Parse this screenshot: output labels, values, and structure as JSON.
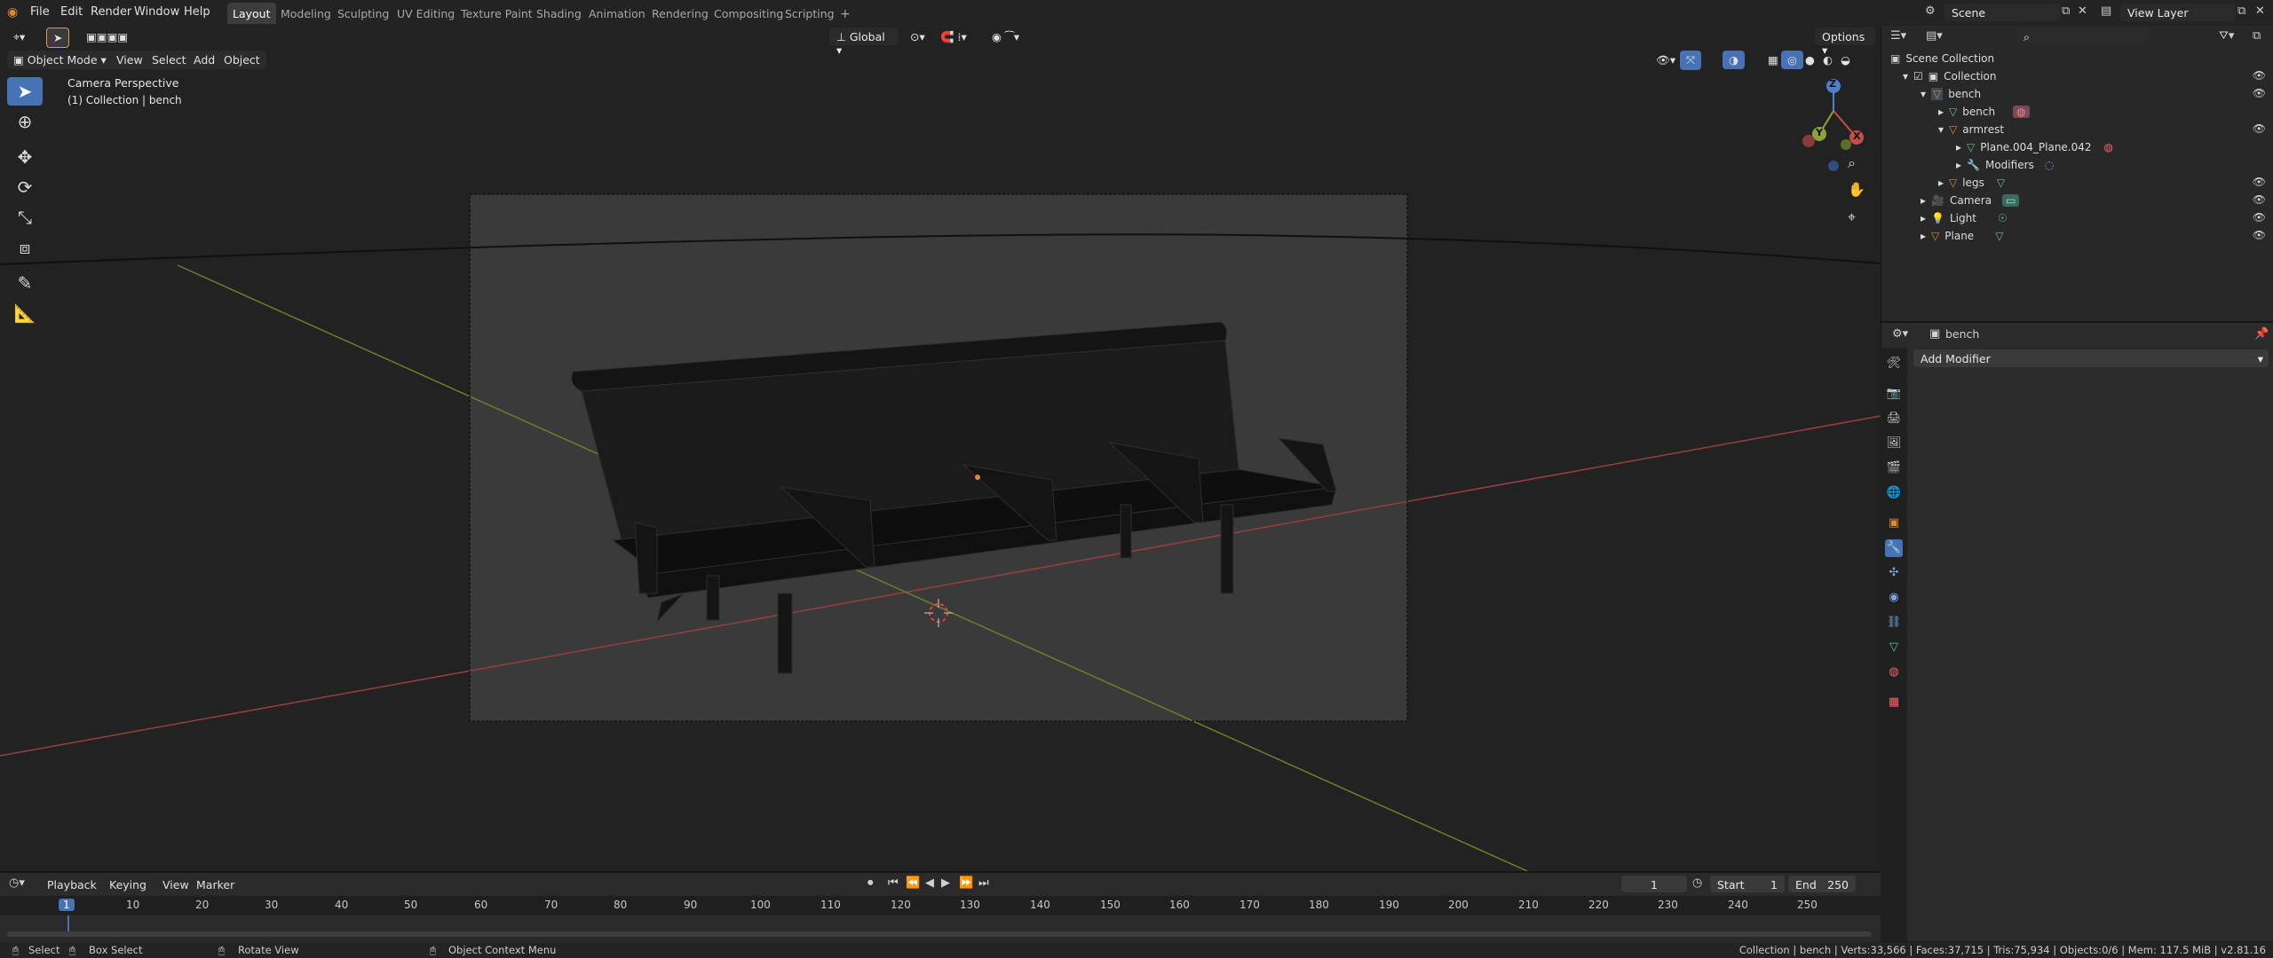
{
  "topbar": {
    "menus": [
      "File",
      "Edit",
      "Render",
      "Window",
      "Help"
    ],
    "workspace_tabs": [
      "Layout",
      "Modeling",
      "Sculpting",
      "UV Editing",
      "Texture Paint",
      "Shading",
      "Animation",
      "Rendering",
      "Compositing",
      "Scripting"
    ],
    "active_tab": "Layout",
    "add_tab_symbol": "+",
    "scene_name": "Scene",
    "view_layer": "View Layer"
  },
  "viewport_header": {
    "transform_orientation": "Global",
    "options_label": "Options",
    "mode": "Object Mode",
    "menus": [
      "View",
      "Select",
      "Add",
      "Object"
    ]
  },
  "viewport": {
    "perspective_label": "Camera Perspective",
    "collection_label": "(1) Collection | bench",
    "gizmo_axes": [
      "Z",
      "Y",
      "X"
    ],
    "colors": {
      "x_axis": "#c64c4c",
      "y_axis": "#8aa43a",
      "z_axis": "#4a7fd1",
      "active": "#4772b3"
    }
  },
  "outliner": {
    "scene_collection": "Scene Collection",
    "items": [
      {
        "label": "Collection",
        "icon": "collection-icon"
      },
      {
        "label": "bench",
        "icon": "empty-icon"
      },
      {
        "label": "bench",
        "icon": "mesh-icon"
      },
      {
        "label": "armrest",
        "icon": "empty-icon"
      },
      {
        "label": "Plane.004_Plane.042",
        "icon": "mesh-icon"
      },
      {
        "label": "Modifiers",
        "icon": "wrench-icon"
      },
      {
        "label": "legs",
        "icon": "empty-icon"
      },
      {
        "label": "Camera",
        "icon": "camera-icon"
      },
      {
        "label": "Light",
        "icon": "light-icon"
      },
      {
        "label": "Plane",
        "icon": "empty-icon"
      }
    ]
  },
  "properties": {
    "object_name": "bench",
    "add_modifier_label": "Add Modifier"
  },
  "timeline": {
    "menus": [
      "Playback",
      "Keying",
      "View",
      "Marker"
    ],
    "current_frame": "1",
    "start_label": "Start",
    "start_value": "1",
    "end_label": "End",
    "end_value": "250",
    "ticks": [
      "1",
      "10",
      "20",
      "30",
      "40",
      "50",
      "60",
      "70",
      "80",
      "90",
      "100",
      "110",
      "120",
      "130",
      "140",
      "150",
      "160",
      "170",
      "180",
      "190",
      "200",
      "210",
      "220",
      "230",
      "240",
      "250"
    ]
  },
  "statusbar": {
    "select": "Select",
    "box_select": "Box Select",
    "rotate_view": "Rotate View",
    "context_menu": "Object Context Menu",
    "stats": "Collection | bench | Verts:33,566 | Faces:37,715 | Tris:75,934 | Objects:0/6 | Mem: 117.5 MiB | v2.81.16"
  }
}
